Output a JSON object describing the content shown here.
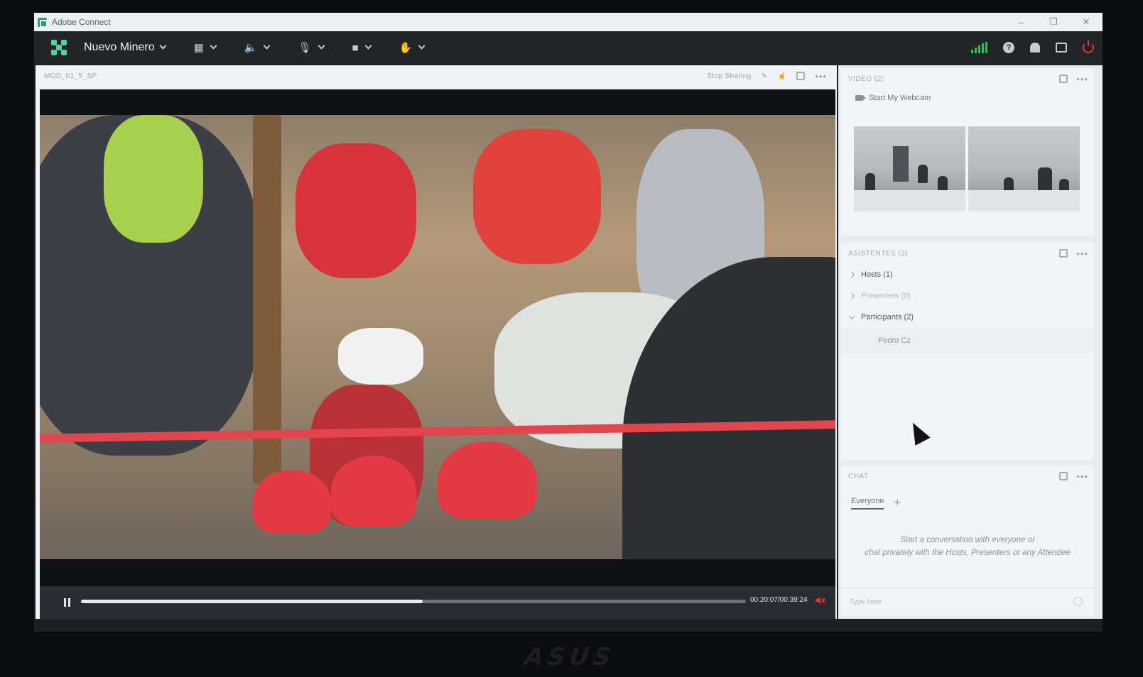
{
  "window": {
    "title": "Adobe Connect"
  },
  "toolbar": {
    "room_name": "Nuevo Minero",
    "icons": [
      "meeting-logo",
      "layouts-grid",
      "speaker",
      "microphone",
      "camera",
      "raise-hand",
      "signal-bars",
      "help",
      "notifications",
      "fullscreen",
      "power"
    ],
    "accent_color": "#4fd39a",
    "signal_color": "#2fc257",
    "power_color": "#e2363b"
  },
  "share_pod": {
    "title": "MOD_01_5_SP",
    "stop_sharing_label": "Stop Sharing",
    "player": {
      "progress": 0.514,
      "timecode": "00:20:07/00:39:24"
    }
  },
  "video_pod": {
    "title": "VIDEO (2)",
    "webcam_button": "Start My Webcam"
  },
  "attendees_pod": {
    "title": "ASISTENTES  (3)",
    "groups": [
      {
        "label": "Hosts (1)"
      },
      {
        "label": "Presenters (0)"
      },
      {
        "label": "Participants (2)"
      }
    ],
    "users": [
      "Pedro Cz"
    ]
  },
  "chat_pod": {
    "title": "CHAT",
    "tab_label": "Everyone",
    "empty_message_line1": "Start a conversation with everyone or",
    "empty_message_line2": "chat privately with the Hosts, Presenters or any Attendee",
    "input_placeholder": "Type here"
  }
}
